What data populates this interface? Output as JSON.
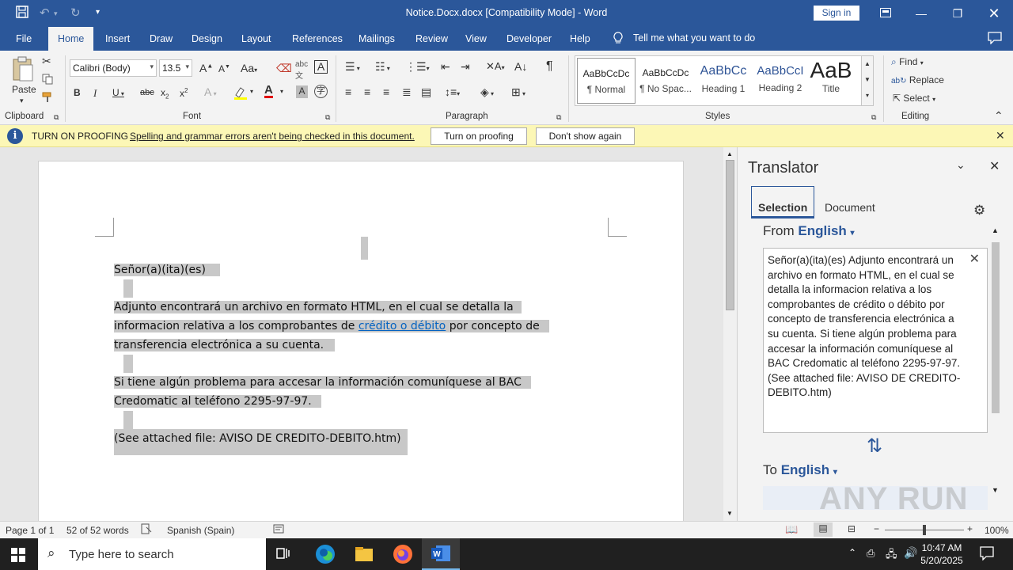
{
  "window": {
    "title": "Notice.Docx.docx  [Compatibility Mode]  -  Word",
    "sign_in": "Sign in"
  },
  "tabs": [
    "File",
    "Home",
    "Insert",
    "Draw",
    "Design",
    "Layout",
    "References",
    "Mailings",
    "Review",
    "View",
    "Developer",
    "Help"
  ],
  "tell_me": "Tell me what you want to do",
  "ribbon": {
    "paste": "Paste",
    "font_name": "Calibri (Body)",
    "font_size": "13.5",
    "groups": {
      "clipboard": "Clipboard",
      "font": "Font",
      "paragraph": "Paragraph",
      "styles": "Styles",
      "editing": "Editing"
    },
    "styles": [
      {
        "sample": "AaBbCcDc",
        "name": "¶ Normal"
      },
      {
        "sample": "AaBbCcDc",
        "name": "¶ No Spac..."
      },
      {
        "sample": "AaBbCc",
        "name": "Heading 1"
      },
      {
        "sample": "AaBbCcI",
        "name": "Heading 2"
      },
      {
        "sample": "AaB",
        "name": "Title"
      }
    ],
    "editing": {
      "find": "Find",
      "replace": "Replace",
      "select": "Select"
    }
  },
  "message_bar": {
    "heading": "TURN ON PROOFING",
    "message": "Spelling and grammar errors aren't being checked in this document.",
    "turn_on": "Turn on proofing",
    "dont_show": "Don't show again"
  },
  "document": {
    "greeting": "Señor(a)(ita)(es)",
    "para1_a": "Adjunto  encontrará un archivo en formato HTML, en el cual se detalla la",
    "para1_b": "informacion relativa a los comprobantes de ",
    "para1_link": "crédito o débito",
    "para1_c": " por concepto de",
    "para1_d": "transferencia electrónica a su cuenta.",
    "para2_a": "Si tiene algún problema para accesar la información comuníquese al BAC",
    "para2_b": "Credomatic al teléfono 2295-97-97.",
    "para3": "(See attached file: AVISO DE CREDITO-DEBITO.htm)"
  },
  "translator": {
    "title": "Translator",
    "tab_selection": "Selection",
    "tab_document": "Document",
    "from_label": "From",
    "from_lang": "English",
    "to_label": "To",
    "to_lang": "English",
    "source_text": "Señor(a)(ita)(es)   Adjunto encontrará un archivo en formato HTML, en el cual se detalla la informacion relativa a los comprobantes de crédito o débito por concepto de transferencia electrónica a su cuenta.  Si tiene algún problema para accesar la información comuníquese al BAC Credomatic al teléfono 2295-97-97.  (See attached file: AVISO DE CREDITO-DEBITO.htm)"
  },
  "status": {
    "page": "Page 1 of 1",
    "words": "52 of 52 words",
    "language": "Spanish (Spain)",
    "zoom": "100%"
  },
  "taskbar": {
    "search_placeholder": "Type here to search",
    "time": "10:47 AM",
    "date": "5/20/2025"
  },
  "watermark": "ANY RUN",
  "colors": {
    "brand": "#2b579a",
    "highlight": "#c8c8c8",
    "message_bar": "#fcf7b6",
    "link": "#0563c1"
  }
}
